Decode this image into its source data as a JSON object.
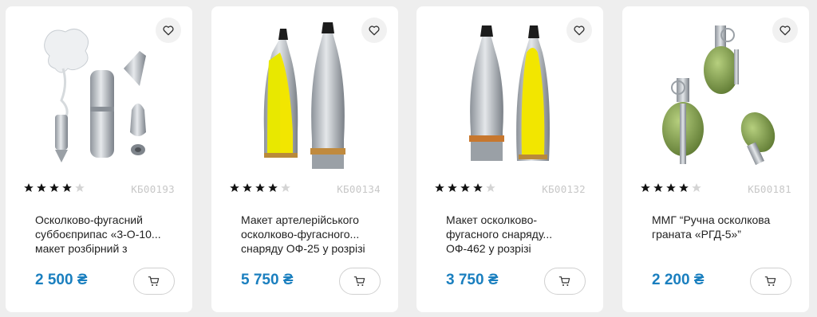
{
  "products": [
    {
      "title_lines": [
        "Осколково-фугасний",
        "суббоєприпас «3-О-10...",
        "макет розбірний з"
      ],
      "sku": "КБ00193",
      "price": "2 500 ₴",
      "rating": 4,
      "rating_max": 5,
      "image": "submunition-disassembled"
    },
    {
      "title_lines": [
        "Макет артелерійського",
        "осколково-фугасного...",
        "снаряду ОФ-25 у розрізі"
      ],
      "sku": "КБ00134",
      "price": "5 750 ₴",
      "rating": 4,
      "rating_max": 5,
      "image": "shell-cutaway-of25"
    },
    {
      "title_lines": [
        "Макет осколково-",
        "фугасного снаряду...",
        "ОФ-462 у розрізі"
      ],
      "sku": "КБ00132",
      "price": "3 750 ₴",
      "rating": 4,
      "rating_max": 5,
      "image": "shell-cutaway-of462"
    },
    {
      "title_lines": [
        "ММГ “Ручна осколкова",
        "граната «РГД-5»”"
      ],
      "sku": "КБ00181",
      "price": "2 200 ₴",
      "rating": 4,
      "rating_max": 5,
      "image": "hand-grenades-rgd5"
    }
  ],
  "colors": {
    "price": "#1a7fbf",
    "star_filled": "#111111",
    "star_empty": "#d4d4d4",
    "card_bg": "#ffffff",
    "page_bg": "#eeeeee"
  },
  "icons": {
    "favorite": "heart-icon",
    "cart": "cart-icon"
  }
}
